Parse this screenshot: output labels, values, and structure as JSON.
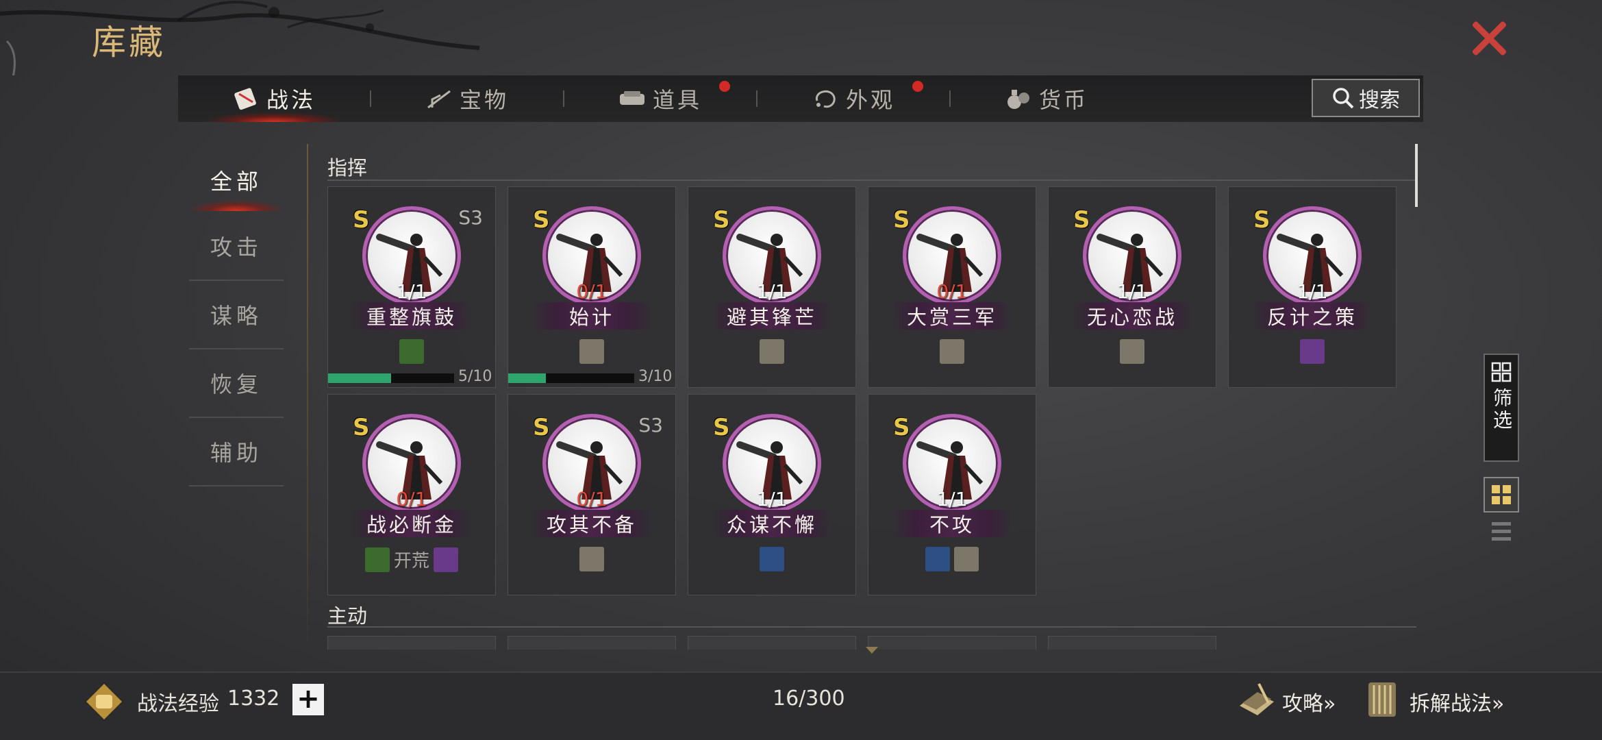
{
  "window": {
    "title": "库藏",
    "close_icon": "close-icon"
  },
  "tabs": [
    {
      "label": "战法",
      "icon": "scroll-bundle-icon",
      "active": true,
      "badge": false
    },
    {
      "label": "宝物",
      "icon": "treasure-icon",
      "active": false,
      "badge": false
    },
    {
      "label": "道具",
      "icon": "item-icon",
      "active": false,
      "badge": true
    },
    {
      "label": "外观",
      "icon": "appearance-icon",
      "active": false,
      "badge": true
    },
    {
      "label": "货币",
      "icon": "currency-bag-icon",
      "active": false,
      "badge": false
    }
  ],
  "search": {
    "label": "搜索"
  },
  "categories": [
    "全部",
    "攻击",
    "谋略",
    "恢复",
    "辅助"
  ],
  "sections": {
    "command": "指挥",
    "active": "主动"
  },
  "cards": [
    {
      "grade": "S",
      "season": "S3",
      "count": "1/1",
      "name": "重整旗鼓",
      "tags": [
        "green"
      ],
      "progress": {
        "value": 5,
        "max": 10,
        "text": "5/10"
      }
    },
    {
      "grade": "S",
      "season": "",
      "count": "0/1",
      "name": "始计",
      "tags": [
        "gray"
      ],
      "progress": {
        "value": 3,
        "max": 10,
        "text": "3/10"
      }
    },
    {
      "grade": "S",
      "season": "",
      "count": "1/1",
      "name": "避其锋芒",
      "tags": [
        "gray"
      ]
    },
    {
      "grade": "S",
      "season": "",
      "count": "0/1",
      "name": "大赏三军",
      "tags": [
        "gray"
      ]
    },
    {
      "grade": "S",
      "season": "",
      "count": "1/1",
      "name": "无心恋战",
      "tags": [
        "gray"
      ]
    },
    {
      "grade": "S",
      "season": "",
      "count": "1/1",
      "name": "反计之策",
      "tags": [
        "purple"
      ]
    },
    {
      "grade": "S",
      "season": "",
      "count": "0/1",
      "name": "战必断金",
      "tags": [
        "green",
        "purple"
      ],
      "tag_text": "开荒"
    },
    {
      "grade": "S",
      "season": "S3",
      "count": "0/1",
      "name": "攻其不备",
      "tags": [
        "gray"
      ]
    },
    {
      "grade": "S",
      "season": "",
      "count": "1/1",
      "name": "众谋不懈",
      "tags": [
        "blue"
      ]
    },
    {
      "grade": "S",
      "season": "",
      "count": "1/1",
      "name": "不攻",
      "tags": [
        "blue",
        "gray"
      ]
    }
  ],
  "filter": {
    "label": "筛选"
  },
  "footer": {
    "exp_label": "战法经验",
    "exp_value": "1332",
    "plus": "+",
    "capacity": "16/300",
    "guide": "攻略»",
    "decompose": "拆解战法»"
  },
  "colors": {
    "accent_red": "#c8413a",
    "title_gold": "#d9b878",
    "grade_gold": "#e8c64a",
    "progress_green": "#2fa56e",
    "zero_red": "#e24a3c",
    "frame_purple": "#b55fb2"
  }
}
